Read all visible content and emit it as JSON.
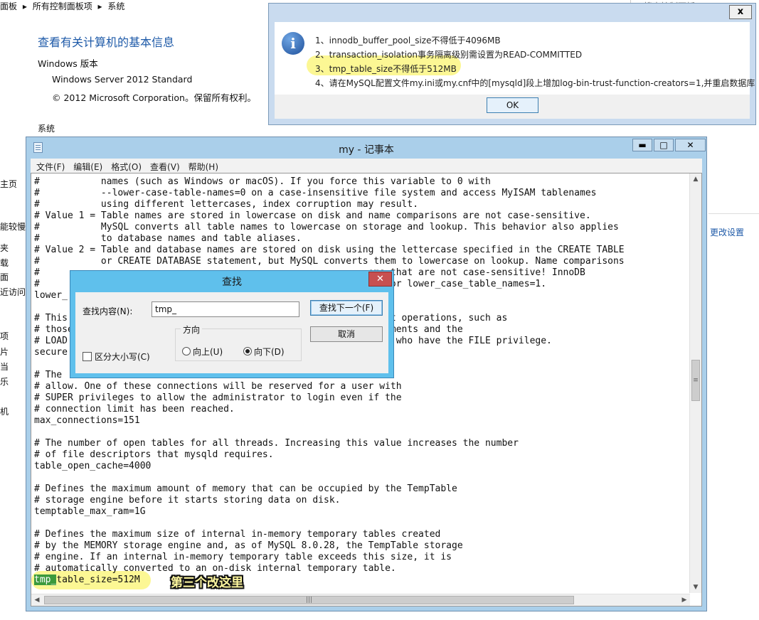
{
  "control_panel": {
    "breadcrumb": [
      "面板",
      "▸",
      "所有控制面板项",
      "▸",
      "系统"
    ],
    "search_placeholder": "搜索控制面板",
    "heading": "查看有关计算机的基本信息",
    "windows_version_label": "Windows 版本",
    "edition": "Windows Server 2012 Standard",
    "copyright": "© 2012 Microsoft Corporation。保留所有权利。",
    "system_label": "系统",
    "left_nav": [
      "主页",
      "能较慢",
      "夹",
      "载",
      "面",
      "近访问的",
      "项",
      "片",
      "当",
      "乐",
      "机"
    ],
    "change_settings_link": "更改设置"
  },
  "notepad": {
    "title": "my - 记事本",
    "menu": [
      "文件(F)",
      "编辑(E)",
      "格式(O)",
      "查看(V)",
      "帮助(H)"
    ],
    "lines": [
      "#           names (such as Windows or macOS). If you force this variable to 0 with",
      "#           --lower-case-table-names=0 on a case-insensitive file system and access MyISAM tablenames",
      "#           using different lettercases, index corruption may result.",
      "# Value 1 = Table names are stored in lowercase on disk and name comparisons are not case-sensitive.",
      "#           MySQL converts all table names to lowercase on storage and lookup. This behavior also applies",
      "#           to database names and table aliases.",
      "# Value 2 = Table and database names are stored on disk using the lettercase specified in the CREATE TABLE",
      "#           or CREATE DATABASE statement, but MySQL converts them to lowercase on lookup. Name comparisons",
      "#                                                           ems that are not case-sensitive! InnoDB",
      "#                                                           as for lower_case_table_names=1.",
      "lower_",
      "",
      "# This                                                      xport operations, such as",
      "# those                                                     tatements and the",
      "# LOAD                                                      sers who have the FILE privilege.",
      "secure",
      "",
      "# The                                                       l",
      "# allow. One of these connections will be reserved for a user with",
      "# SUPER privileges to allow the administrator to login even if the",
      "# connection limit has been reached.",
      "max_connections=151",
      "",
      "# The number of open tables for all threads. Increasing this value increases the number",
      "# of file descriptors that mysqld requires.",
      "table_open_cache=4000",
      "",
      "# Defines the maximum amount of memory that can be occupied by the TempTable",
      "# storage engine before it starts storing data on disk.",
      "temptable_max_ram=1G",
      "",
      "# Defines the maximum size of internal in-memory temporary tables created",
      "# by the MEMORY storage engine and, as of MySQL 8.0.28, the TempTable storage",
      "# engine. If an internal in-memory temporary table exceeds this size, it is",
      "# automatically converted to an on-disk internal temporary table."
    ],
    "selected_text": "tmp_",
    "last_line_rest": "table_size=512M",
    "caption": "第三个改这里"
  },
  "find_dialog": {
    "title": "查找",
    "find_label": "查找内容(N):",
    "find_value": "tmp_",
    "find_next": "查找下一个(F)",
    "cancel": "取消",
    "direction_label": "方向",
    "up": "向上(U)",
    "down": "向下(D)",
    "direction_selected": "down",
    "match_case": "区分大小写(C)"
  },
  "message_box": {
    "lines": [
      "1、innodb_buffer_pool_size不得低于4096MB",
      "2、transaction_isolation事务隔离级别需设置为READ-COMMITTED",
      "3、tmp_table_size不得低于512MB",
      "4、请在MySQL配置文件my.ini或my.cnf中的[mysqld]段上增加log-bin-trust-function-creators=1,并重启数据库"
    ],
    "ok": "OK",
    "close": "x"
  },
  "colors": {
    "notepad_frame": "#aacfea",
    "find_frame": "#5fc0ec",
    "highlight": "#f5ee3a",
    "selection": "#3c9a3c",
    "link": "#1e5aa8"
  },
  "icons": [
    "info-icon",
    "notepad-icon",
    "close-icon",
    "minimize-icon",
    "maximize-icon",
    "scroll-up-icon",
    "scroll-down-icon",
    "scroll-left-icon",
    "scroll-right-icon"
  ]
}
